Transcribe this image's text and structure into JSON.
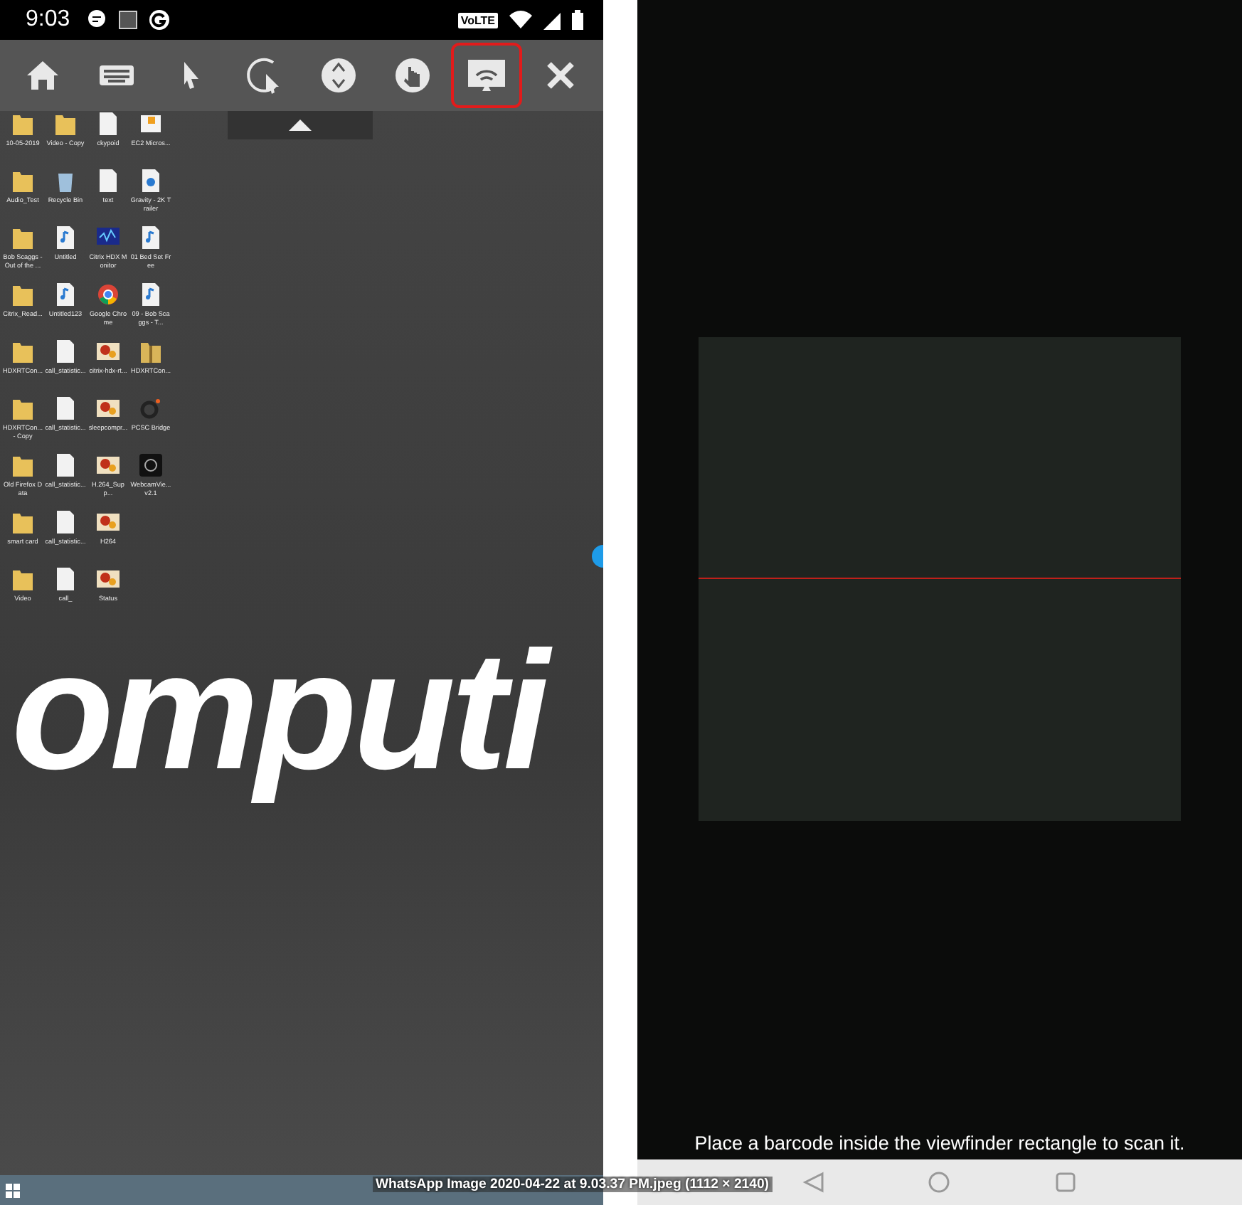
{
  "left_screen": {
    "status_bar": {
      "time": "9:03",
      "network_badge": "VoLTE"
    },
    "toolbar": [
      {
        "kind": "home",
        "selected": false
      },
      {
        "kind": "keyboard",
        "selected": false
      },
      {
        "kind": "pointer",
        "selected": false
      },
      {
        "kind": "circle-pointer",
        "selected": false
      },
      {
        "kind": "scroll",
        "selected": false
      },
      {
        "kind": "touch",
        "selected": false
      },
      {
        "kind": "cast",
        "selected": true
      },
      {
        "kind": "close",
        "selected": false
      }
    ],
    "desktop_icons": [
      {
        "kind": "folder",
        "label": "10-05-2019"
      },
      {
        "kind": "folder",
        "label": "Video - Copy"
      },
      {
        "kind": "doc",
        "label": "ckypoid"
      },
      {
        "kind": "shortcut",
        "label": "EC2 Micros..."
      },
      {
        "kind": "folder",
        "label": "Audio_Test"
      },
      {
        "kind": "bin",
        "label": "Recycle Bin"
      },
      {
        "kind": "doc",
        "label": "text"
      },
      {
        "kind": "media",
        "label": "Gravity - 2K Trailer"
      },
      {
        "kind": "folder",
        "label": "Bob Scaggs - Out of the ..."
      },
      {
        "kind": "audio",
        "label": "Untitled"
      },
      {
        "kind": "monitor",
        "label": "Citrix HDX Monitor"
      },
      {
        "kind": "audio",
        "label": "01 Bed Set Free"
      },
      {
        "kind": "folder",
        "label": "Citrix_Read..."
      },
      {
        "kind": "audio",
        "label": "Untitled123"
      },
      {
        "kind": "chrome",
        "label": "Google Chrome"
      },
      {
        "kind": "audio",
        "label": "09 - Bob Scaggs - T..."
      },
      {
        "kind": "folder",
        "label": "HDXRTCon..."
      },
      {
        "kind": "doc",
        "label": "call_statistic..."
      },
      {
        "kind": "image",
        "label": "citrix-hdx-rt..."
      },
      {
        "kind": "zip",
        "label": "HDXRTCon..."
      },
      {
        "kind": "folder",
        "label": "HDXRTCon... - Copy"
      },
      {
        "kind": "doc",
        "label": "call_statistic..."
      },
      {
        "kind": "image",
        "label": "sleepcompr..."
      },
      {
        "kind": "bridge",
        "label": "PCSC Bridge"
      },
      {
        "kind": "folder",
        "label": "Old Firefox Data"
      },
      {
        "kind": "doc",
        "label": "call_statistic..."
      },
      {
        "kind": "image",
        "label": "H.264_Supp..."
      },
      {
        "kind": "camera",
        "label": "WebcamVie... v2.1"
      },
      {
        "kind": "folder",
        "label": "smart card"
      },
      {
        "kind": "doc",
        "label": "call_statistic..."
      },
      {
        "kind": "image",
        "label": "H264"
      },
      {
        "kind": "empty"
      },
      {
        "kind": "folder",
        "label": "Video"
      },
      {
        "kind": "doc",
        "label": "call_"
      },
      {
        "kind": "image",
        "label": "Status"
      }
    ],
    "wallpaper_text": "omputi"
  },
  "right_screen": {
    "scan_hint": "Place a barcode inside the viewfinder rectangle to scan it."
  },
  "image_caption": "WhatsApp Image 2020-04-22 at 9.03.37 PM.jpeg (1112 × 2140)"
}
